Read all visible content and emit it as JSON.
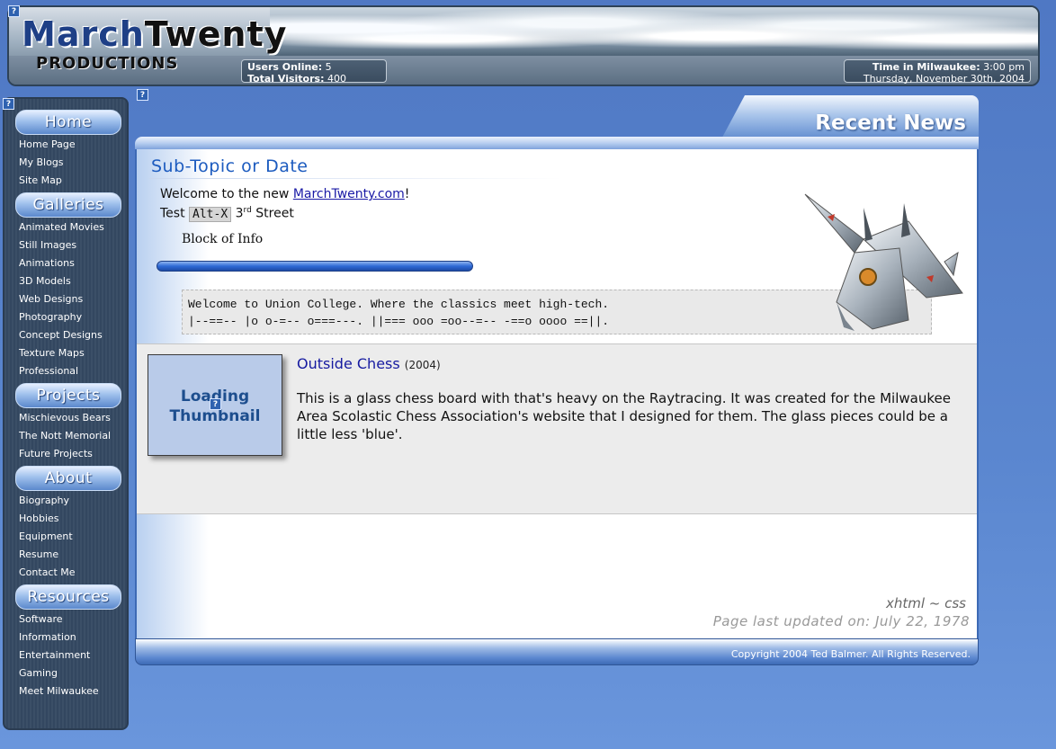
{
  "header": {
    "logo_line1_a": "March",
    "logo_line1_b": "Twenty",
    "logo_line2": "PRODUCTIONS",
    "stats": {
      "users_online_label": "Users Online:",
      "users_online_value": "5",
      "total_visitors_label": "Total Visitors:",
      "total_visitors_value": "400"
    },
    "time": {
      "label": "Time in Milwaukee:",
      "value": "3:00 pm",
      "date": "Thursday, November 30th, 2004"
    }
  },
  "sidebar": {
    "sections": [
      {
        "title": "Home",
        "items": [
          "Home Page",
          "My Blogs",
          "Site Map"
        ]
      },
      {
        "title": "Galleries",
        "items": [
          "Animated Movies",
          "Still Images",
          "Animations",
          "3D Models",
          "Web Designs",
          "Photography",
          "Concept Designs",
          "Texture Maps",
          "Professional"
        ]
      },
      {
        "title": "Projects",
        "items": [
          "Mischievous Bears",
          "The Nott Memorial",
          "Future Projects"
        ]
      },
      {
        "title": "About",
        "items": [
          "Biography",
          "Hobbies",
          "Equipment",
          "Resume",
          "Contact Me"
        ]
      },
      {
        "title": "Resources",
        "items": [
          "Software",
          "Information",
          "Entertainment",
          "Gaming",
          "Meet Milwaukee"
        ]
      }
    ]
  },
  "main": {
    "tab_title": "Recent News",
    "subtopic": "Sub-Topic or Date",
    "welcome_prefix": "Welcome to the new ",
    "welcome_link": "MarchTwenty.com",
    "welcome_suffix": "!",
    "test_prefix": "Test ",
    "test_kbd": "Alt-X",
    "test_number": "3",
    "test_sup": "rd",
    "test_suffix": " Street",
    "block_info": "Block of Info",
    "code_line1": "Welcome to Union College. Where the classics meet high-tech.",
    "code_line2": "|--==-- |o o-=-- o===---. ||=== ooo =oo--=-- -==o oooo ==||.",
    "thumbnail_text": "Loading Thumbnail",
    "item_title": "Outside Chess",
    "item_year": "(2004)",
    "item_desc": "This is a glass chess board with that's heavy on the Raytracing. It was created for the Milwaukee Area Scolastic Chess Association's website that I designed for them. The glass pieces could be a little less 'blue'.",
    "footer_note1": "xhtml ~ css",
    "footer_note2": "Page last updated on: July 22, 1978",
    "copyright": "Copyright 2004 Ted Balmer. All Rights Reserved."
  },
  "icons": {
    "broken_image": "question-icon"
  }
}
